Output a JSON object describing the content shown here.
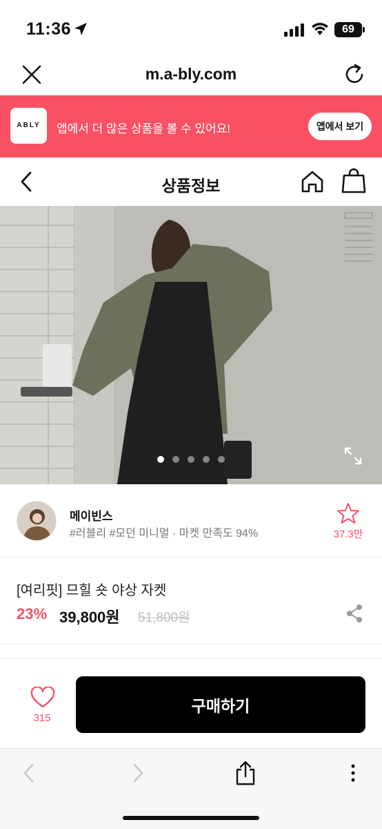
{
  "status_bar": {
    "time": "11:36",
    "battery": "69"
  },
  "browser": {
    "url": "m.a-bly.com"
  },
  "app_banner": {
    "logo": "ABLY",
    "text": "앱에서 더 많은 상품을 볼 수 있어요!",
    "button": "앱에서 보기"
  },
  "header": {
    "title": "상품정보"
  },
  "carousel": {
    "total": 5,
    "active_index": 0
  },
  "seller": {
    "name": "메이빈스",
    "tags": "#러블리 #모던 미니멀 · 마켓 만족도 94%",
    "favorites": "37.3만"
  },
  "product": {
    "name": "[여리핏] 므힐 숏 야상 자켓",
    "discount": "23%",
    "price": "39,800원",
    "original_price": "51,800원"
  },
  "purchase": {
    "like_count": "315",
    "buy_label": "구매하기"
  },
  "icons": {
    "close": "close-icon",
    "reload": "reload-icon",
    "back": "chevron-left-icon",
    "home": "home-icon",
    "bag": "shopping-bag-icon",
    "expand": "expand-icon",
    "star": "star-outline-icon",
    "share": "share-icon",
    "heart": "heart-outline-icon",
    "browser_share": "share-upload-icon",
    "more": "more-vertical-icon"
  },
  "colors": {
    "accent": "#fa5064",
    "buy_button": "#000000"
  }
}
